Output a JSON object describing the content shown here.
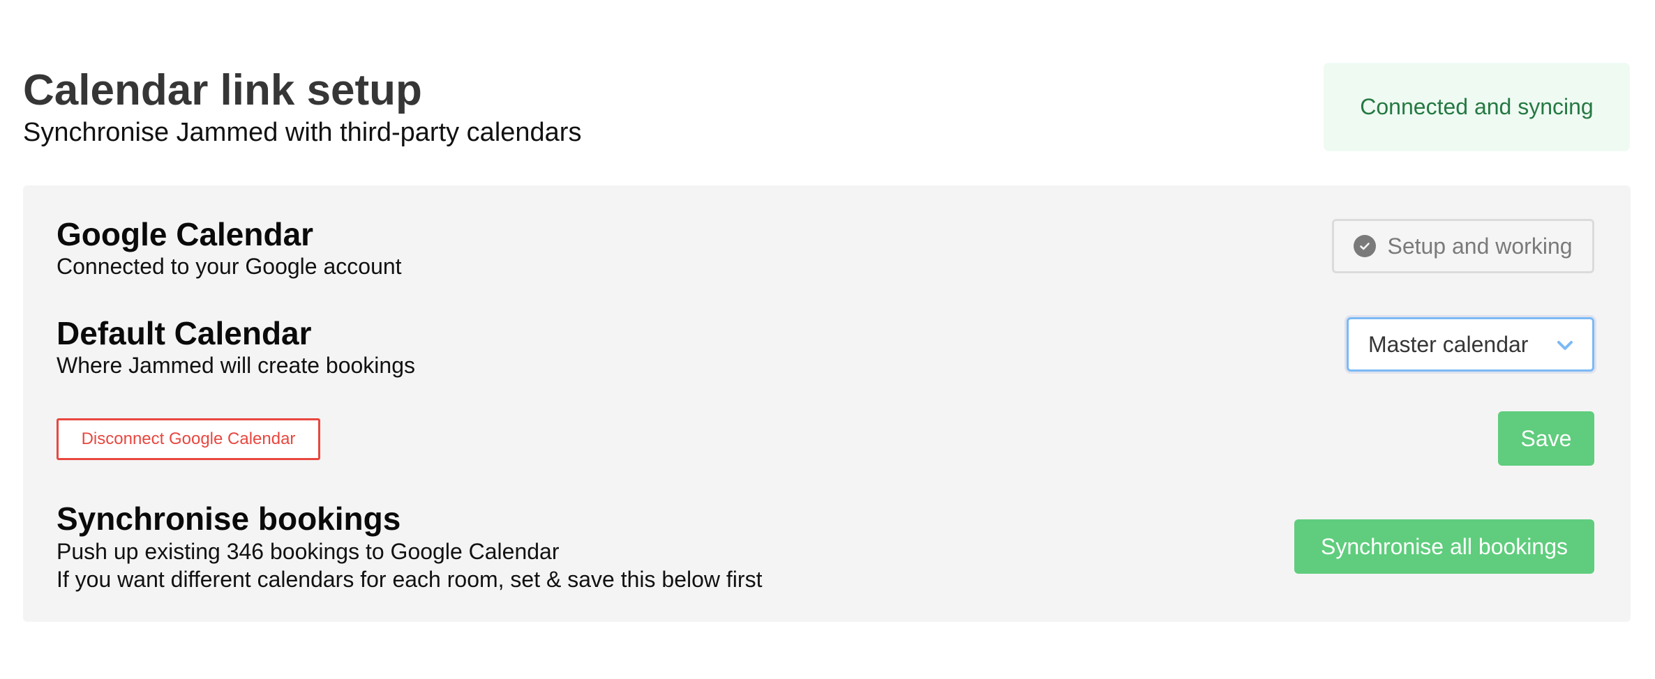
{
  "header": {
    "title": "Calendar link setup",
    "subtitle": "Synchronise Jammed with third-party calendars"
  },
  "status_banner": {
    "text": "Connected and syncing",
    "background": "#effaf3",
    "color": "#257942"
  },
  "google_calendar": {
    "title": "Google Calendar",
    "description": "Connected to your Google account",
    "status_label": "Setup and working",
    "status_icon": "check-circle-icon"
  },
  "default_calendar": {
    "title": "Default Calendar",
    "description": "Where Jammed will create bookings",
    "selected_value": "Master calendar",
    "dropdown_icon": "chevron-down-icon"
  },
  "actions": {
    "disconnect_label": "Disconnect Google Calendar",
    "save_label": "Save"
  },
  "sync_bookings": {
    "title": "Synchronise bookings",
    "description_line1": "Push up existing 346 bookings to Google Calendar",
    "description_line2": "If you want different calendars for each room, set & save this below first",
    "button_label": "Synchronise all bookings"
  },
  "colors": {
    "accent_green": "#5fcd7d",
    "danger_red": "#e8473f",
    "focus_blue": "#7cb9f5",
    "panel_background": "#f4f4f4"
  }
}
